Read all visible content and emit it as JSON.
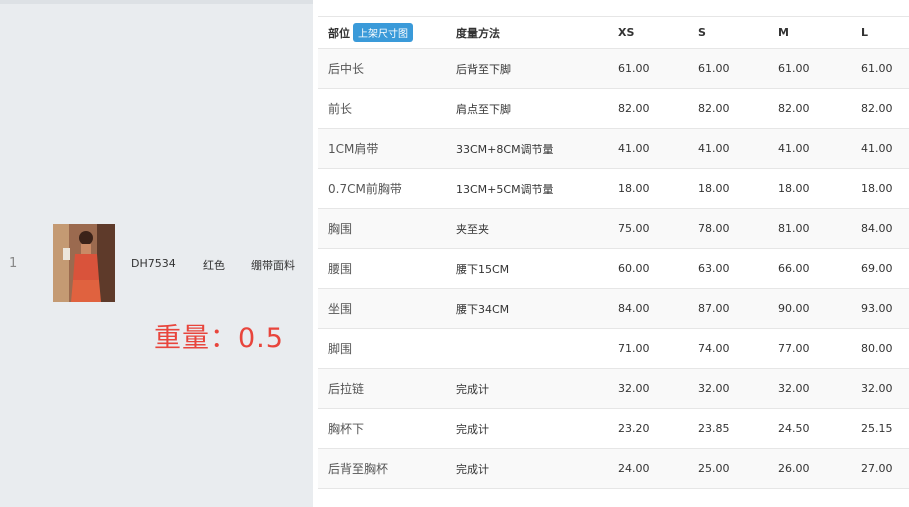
{
  "product": {
    "row_index": "1",
    "sku": "DH7534",
    "color": "红色",
    "material": "绷带面料",
    "weight_label": "重量：0.5"
  },
  "table": {
    "headers": {
      "part": "部位",
      "badge": "上架尺寸图",
      "method": "度量方法",
      "sizes": [
        "XS",
        "S",
        "M",
        "L"
      ]
    },
    "rows": [
      {
        "part": "后中长",
        "method": "后背至下脚",
        "values": [
          "61.00",
          "61.00",
          "61.00",
          "61.00"
        ]
      },
      {
        "part": "前长",
        "method": "肩点至下脚",
        "values": [
          "82.00",
          "82.00",
          "82.00",
          "82.00"
        ]
      },
      {
        "part": "1CM肩带",
        "method": "33CM+8CM调节量",
        "values": [
          "41.00",
          "41.00",
          "41.00",
          "41.00"
        ]
      },
      {
        "part": "0.7CM前胸带",
        "method": "13CM+5CM调节量",
        "values": [
          "18.00",
          "18.00",
          "18.00",
          "18.00"
        ]
      },
      {
        "part": "胸围",
        "method": "夹至夹",
        "values": [
          "75.00",
          "78.00",
          "81.00",
          "84.00"
        ]
      },
      {
        "part": "腰围",
        "method": "腰下15CM",
        "values": [
          "60.00",
          "63.00",
          "66.00",
          "69.00"
        ]
      },
      {
        "part": "坐围",
        "method": "腰下34CM",
        "values": [
          "84.00",
          "87.00",
          "90.00",
          "93.00"
        ]
      },
      {
        "part": "脚围",
        "method": "",
        "values": [
          "71.00",
          "74.00",
          "77.00",
          "80.00"
        ]
      },
      {
        "part": "后拉链",
        "method": "完成计",
        "values": [
          "32.00",
          "32.00",
          "32.00",
          "32.00"
        ]
      },
      {
        "part": "胸杯下",
        "method": "完成计",
        "values": [
          "23.20",
          "23.85",
          "24.50",
          "25.15"
        ]
      },
      {
        "part": "后背至胸杯",
        "method": "完成计",
        "values": [
          "24.00",
          "25.00",
          "26.00",
          "27.00"
        ]
      }
    ]
  }
}
